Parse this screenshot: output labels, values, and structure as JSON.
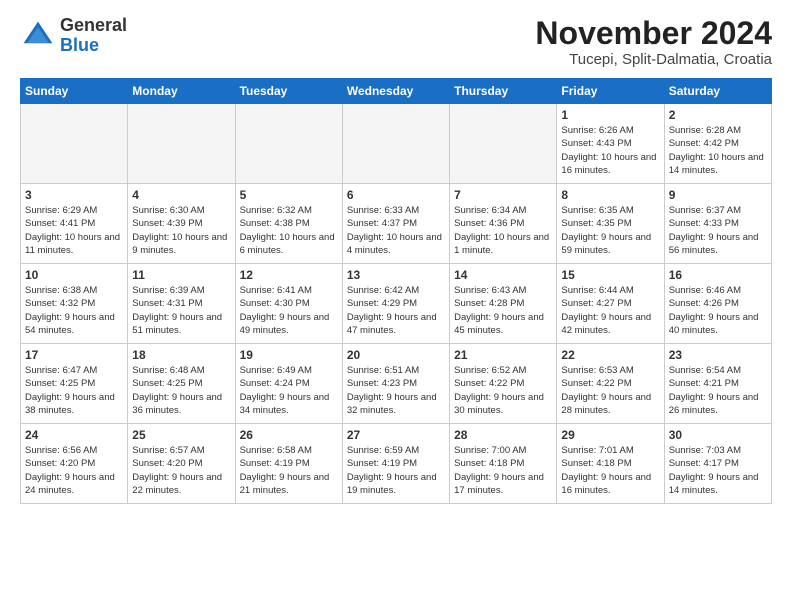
{
  "logo": {
    "general": "General",
    "blue": "Blue"
  },
  "header": {
    "month": "November 2024",
    "location": "Tucepi, Split-Dalmatia, Croatia"
  },
  "weekdays": [
    "Sunday",
    "Monday",
    "Tuesday",
    "Wednesday",
    "Thursday",
    "Friday",
    "Saturday"
  ],
  "weeks": [
    [
      {
        "day": "",
        "empty": true
      },
      {
        "day": "",
        "empty": true
      },
      {
        "day": "",
        "empty": true
      },
      {
        "day": "",
        "empty": true
      },
      {
        "day": "",
        "empty": true
      },
      {
        "day": "1",
        "sunrise": "6:26 AM",
        "sunset": "4:43 PM",
        "daylight": "10 hours and 16 minutes."
      },
      {
        "day": "2",
        "sunrise": "6:28 AM",
        "sunset": "4:42 PM",
        "daylight": "10 hours and 14 minutes."
      }
    ],
    [
      {
        "day": "3",
        "sunrise": "6:29 AM",
        "sunset": "4:41 PM",
        "daylight": "10 hours and 11 minutes."
      },
      {
        "day": "4",
        "sunrise": "6:30 AM",
        "sunset": "4:39 PM",
        "daylight": "10 hours and 9 minutes."
      },
      {
        "day": "5",
        "sunrise": "6:32 AM",
        "sunset": "4:38 PM",
        "daylight": "10 hours and 6 minutes."
      },
      {
        "day": "6",
        "sunrise": "6:33 AM",
        "sunset": "4:37 PM",
        "daylight": "10 hours and 4 minutes."
      },
      {
        "day": "7",
        "sunrise": "6:34 AM",
        "sunset": "4:36 PM",
        "daylight": "10 hours and 1 minute."
      },
      {
        "day": "8",
        "sunrise": "6:35 AM",
        "sunset": "4:35 PM",
        "daylight": "9 hours and 59 minutes."
      },
      {
        "day": "9",
        "sunrise": "6:37 AM",
        "sunset": "4:33 PM",
        "daylight": "9 hours and 56 minutes."
      }
    ],
    [
      {
        "day": "10",
        "sunrise": "6:38 AM",
        "sunset": "4:32 PM",
        "daylight": "9 hours and 54 minutes."
      },
      {
        "day": "11",
        "sunrise": "6:39 AM",
        "sunset": "4:31 PM",
        "daylight": "9 hours and 51 minutes."
      },
      {
        "day": "12",
        "sunrise": "6:41 AM",
        "sunset": "4:30 PM",
        "daylight": "9 hours and 49 minutes."
      },
      {
        "day": "13",
        "sunrise": "6:42 AM",
        "sunset": "4:29 PM",
        "daylight": "9 hours and 47 minutes."
      },
      {
        "day": "14",
        "sunrise": "6:43 AM",
        "sunset": "4:28 PM",
        "daylight": "9 hours and 45 minutes."
      },
      {
        "day": "15",
        "sunrise": "6:44 AM",
        "sunset": "4:27 PM",
        "daylight": "9 hours and 42 minutes."
      },
      {
        "day": "16",
        "sunrise": "6:46 AM",
        "sunset": "4:26 PM",
        "daylight": "9 hours and 40 minutes."
      }
    ],
    [
      {
        "day": "17",
        "sunrise": "6:47 AM",
        "sunset": "4:25 PM",
        "daylight": "9 hours and 38 minutes."
      },
      {
        "day": "18",
        "sunrise": "6:48 AM",
        "sunset": "4:25 PM",
        "daylight": "9 hours and 36 minutes."
      },
      {
        "day": "19",
        "sunrise": "6:49 AM",
        "sunset": "4:24 PM",
        "daylight": "9 hours and 34 minutes."
      },
      {
        "day": "20",
        "sunrise": "6:51 AM",
        "sunset": "4:23 PM",
        "daylight": "9 hours and 32 minutes."
      },
      {
        "day": "21",
        "sunrise": "6:52 AM",
        "sunset": "4:22 PM",
        "daylight": "9 hours and 30 minutes."
      },
      {
        "day": "22",
        "sunrise": "6:53 AM",
        "sunset": "4:22 PM",
        "daylight": "9 hours and 28 minutes."
      },
      {
        "day": "23",
        "sunrise": "6:54 AM",
        "sunset": "4:21 PM",
        "daylight": "9 hours and 26 minutes."
      }
    ],
    [
      {
        "day": "24",
        "sunrise": "6:56 AM",
        "sunset": "4:20 PM",
        "daylight": "9 hours and 24 minutes."
      },
      {
        "day": "25",
        "sunrise": "6:57 AM",
        "sunset": "4:20 PM",
        "daylight": "9 hours and 22 minutes."
      },
      {
        "day": "26",
        "sunrise": "6:58 AM",
        "sunset": "4:19 PM",
        "daylight": "9 hours and 21 minutes."
      },
      {
        "day": "27",
        "sunrise": "6:59 AM",
        "sunset": "4:19 PM",
        "daylight": "9 hours and 19 minutes."
      },
      {
        "day": "28",
        "sunrise": "7:00 AM",
        "sunset": "4:18 PM",
        "daylight": "9 hours and 17 minutes."
      },
      {
        "day": "29",
        "sunrise": "7:01 AM",
        "sunset": "4:18 PM",
        "daylight": "9 hours and 16 minutes."
      },
      {
        "day": "30",
        "sunrise": "7:03 AM",
        "sunset": "4:17 PM",
        "daylight": "9 hours and 14 minutes."
      }
    ]
  ]
}
